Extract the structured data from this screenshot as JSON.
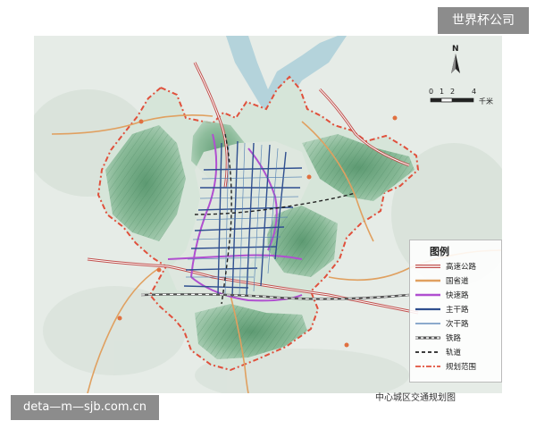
{
  "watermark_top_right": "世界杯公司",
  "watermark_bottom_left": "deta—m—sjb.com.cn",
  "bottom_caption": "中心城区交通规划图",
  "north_label": "N",
  "scale": {
    "ticks": [
      "0",
      "1",
      "2",
      "4"
    ],
    "unit": "千米"
  },
  "legend": {
    "title": "图例",
    "items": [
      {
        "label": "高速公路",
        "color": "#c0504d",
        "style": "double"
      },
      {
        "label": "国省道",
        "color": "#e0a060",
        "style": "solid"
      },
      {
        "label": "快速路",
        "color": "#b04fd0",
        "style": "solid"
      },
      {
        "label": "主干路",
        "color": "#2f4f8f",
        "style": "solid"
      },
      {
        "label": "次干路",
        "color": "#4a7ab0",
        "style": "thin"
      },
      {
        "label": "铁路",
        "color": "#555555",
        "style": "rail"
      },
      {
        "label": "轨道",
        "color": "#222222",
        "style": "dashed"
      },
      {
        "label": "规划范围",
        "color": "#e0503c",
        "style": "dashdot"
      }
    ]
  }
}
